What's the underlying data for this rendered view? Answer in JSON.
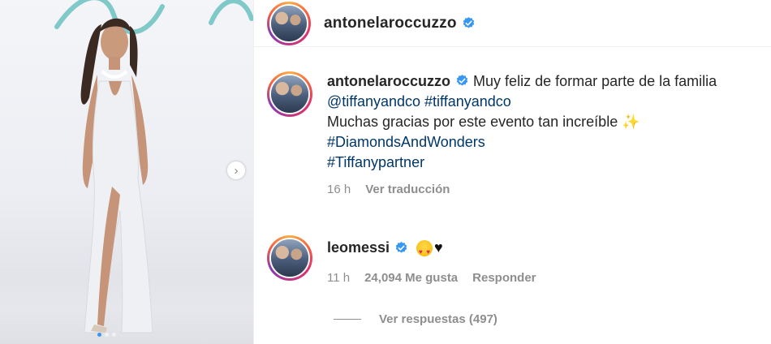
{
  "post": {
    "owner": {
      "username": "antonelaroccuzzo",
      "verified": true
    }
  },
  "caption": {
    "username": "antonelaroccuzzo",
    "text_lead": "Muy feliz de formar parte de la familia",
    "mention": "@tiffanyandco",
    "hashtag_1": "#tiffanyandco",
    "text_line2": "Muchas gracias por este evento tan increíble",
    "sparkle": "✨",
    "hashtag_2": "#DiamondsAndWonders",
    "hashtag_3": "#Tiffanypartner",
    "time": "16 h",
    "translate_label": "Ver traducción"
  },
  "comment": {
    "username": "leomessi",
    "verified": true,
    "heart": "♥",
    "time": "11 h",
    "likes": "24,094 Me gusta",
    "reply_label": "Responder",
    "view_replies": "Ver respuestas (497)"
  },
  "icons": {
    "verified": "verified-badge-icon",
    "next": "chevron-right-icon",
    "emoji": "heart-eyes-emoji-icon"
  },
  "colors": {
    "verified_blue": "#3897f0",
    "hashtag_blue": "#00376b",
    "meta_grey": "#8e8e8e"
  }
}
